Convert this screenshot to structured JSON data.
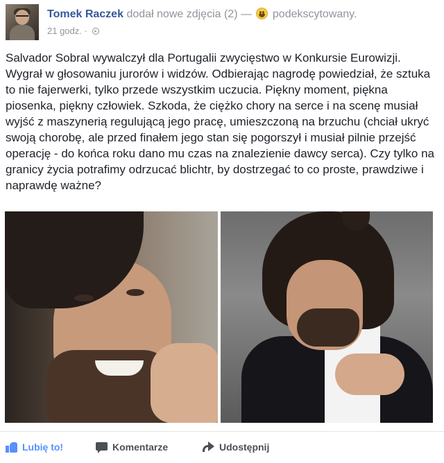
{
  "header": {
    "author": "Tomek Raczek",
    "action": "dodał nowe zdjęcia (2) —",
    "emoji_icon": "smile-emoji-icon",
    "feeling": "podekscytowany.",
    "time": "21 godz. ·",
    "privacy_icon": "globe-icon"
  },
  "post": {
    "text": "Salvador Sobral wywalczył dla Portugalii zwycięstwo w Konkursie Eurowizji. Wygrał w głosowaniu jurorów i widzów. Odbierając nagrodę powiedział, że sztuka to nie fajerwerki, tylko przede wszystkim uczucia. Piękny moment, piękna piosenka, piękny człowiek. Szkoda, że ciężko chory na serce i na scenę musiał wyjść z maszynerią regulującą jego pracę, umieszczoną na brzuchu (chciał ukryć swoją chorobę, ale przed finałem jego stan się pogorszył i musiał pilnie przejść operację - do końca roku dano mu czas na znalezienie dawcy serca). Czy tylko na granicy życia potrafimy odrzucać blichtr, by dostrzegać to co proste, prawdziwe i naprawdę ważne?"
  },
  "actions": {
    "like": "Lubię to!",
    "comment": "Komentarze",
    "share": "Udostępnij"
  },
  "colors": {
    "link": "#365899",
    "meta": "#90949c",
    "like_accent": "#5890ff"
  }
}
